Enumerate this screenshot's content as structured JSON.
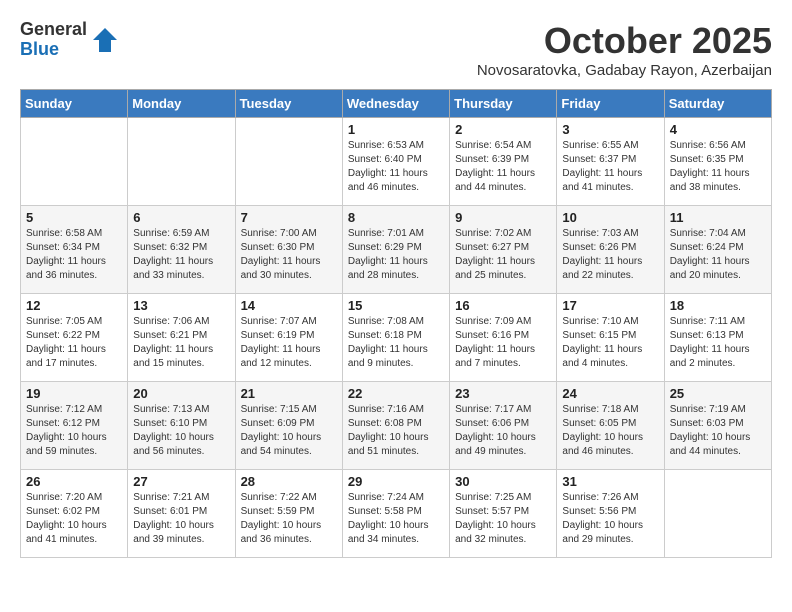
{
  "header": {
    "logo_general": "General",
    "logo_blue": "Blue",
    "month_title": "October 2025",
    "location": "Novosaratovka, Gadabay Rayon, Azerbaijan"
  },
  "weekdays": [
    "Sunday",
    "Monday",
    "Tuesday",
    "Wednesday",
    "Thursday",
    "Friday",
    "Saturday"
  ],
  "weeks": [
    [
      {
        "day": "",
        "info": ""
      },
      {
        "day": "",
        "info": ""
      },
      {
        "day": "",
        "info": ""
      },
      {
        "day": "1",
        "info": "Sunrise: 6:53 AM\nSunset: 6:40 PM\nDaylight: 11 hours\nand 46 minutes."
      },
      {
        "day": "2",
        "info": "Sunrise: 6:54 AM\nSunset: 6:39 PM\nDaylight: 11 hours\nand 44 minutes."
      },
      {
        "day": "3",
        "info": "Sunrise: 6:55 AM\nSunset: 6:37 PM\nDaylight: 11 hours\nand 41 minutes."
      },
      {
        "day": "4",
        "info": "Sunrise: 6:56 AM\nSunset: 6:35 PM\nDaylight: 11 hours\nand 38 minutes."
      }
    ],
    [
      {
        "day": "5",
        "info": "Sunrise: 6:58 AM\nSunset: 6:34 PM\nDaylight: 11 hours\nand 36 minutes."
      },
      {
        "day": "6",
        "info": "Sunrise: 6:59 AM\nSunset: 6:32 PM\nDaylight: 11 hours\nand 33 minutes."
      },
      {
        "day": "7",
        "info": "Sunrise: 7:00 AM\nSunset: 6:30 PM\nDaylight: 11 hours\nand 30 minutes."
      },
      {
        "day": "8",
        "info": "Sunrise: 7:01 AM\nSunset: 6:29 PM\nDaylight: 11 hours\nand 28 minutes."
      },
      {
        "day": "9",
        "info": "Sunrise: 7:02 AM\nSunset: 6:27 PM\nDaylight: 11 hours\nand 25 minutes."
      },
      {
        "day": "10",
        "info": "Sunrise: 7:03 AM\nSunset: 6:26 PM\nDaylight: 11 hours\nand 22 minutes."
      },
      {
        "day": "11",
        "info": "Sunrise: 7:04 AM\nSunset: 6:24 PM\nDaylight: 11 hours\nand 20 minutes."
      }
    ],
    [
      {
        "day": "12",
        "info": "Sunrise: 7:05 AM\nSunset: 6:22 PM\nDaylight: 11 hours\nand 17 minutes."
      },
      {
        "day": "13",
        "info": "Sunrise: 7:06 AM\nSunset: 6:21 PM\nDaylight: 11 hours\nand 15 minutes."
      },
      {
        "day": "14",
        "info": "Sunrise: 7:07 AM\nSunset: 6:19 PM\nDaylight: 11 hours\nand 12 minutes."
      },
      {
        "day": "15",
        "info": "Sunrise: 7:08 AM\nSunset: 6:18 PM\nDaylight: 11 hours\nand 9 minutes."
      },
      {
        "day": "16",
        "info": "Sunrise: 7:09 AM\nSunset: 6:16 PM\nDaylight: 11 hours\nand 7 minutes."
      },
      {
        "day": "17",
        "info": "Sunrise: 7:10 AM\nSunset: 6:15 PM\nDaylight: 11 hours\nand 4 minutes."
      },
      {
        "day": "18",
        "info": "Sunrise: 7:11 AM\nSunset: 6:13 PM\nDaylight: 11 hours\nand 2 minutes."
      }
    ],
    [
      {
        "day": "19",
        "info": "Sunrise: 7:12 AM\nSunset: 6:12 PM\nDaylight: 10 hours\nand 59 minutes."
      },
      {
        "day": "20",
        "info": "Sunrise: 7:13 AM\nSunset: 6:10 PM\nDaylight: 10 hours\nand 56 minutes."
      },
      {
        "day": "21",
        "info": "Sunrise: 7:15 AM\nSunset: 6:09 PM\nDaylight: 10 hours\nand 54 minutes."
      },
      {
        "day": "22",
        "info": "Sunrise: 7:16 AM\nSunset: 6:08 PM\nDaylight: 10 hours\nand 51 minutes."
      },
      {
        "day": "23",
        "info": "Sunrise: 7:17 AM\nSunset: 6:06 PM\nDaylight: 10 hours\nand 49 minutes."
      },
      {
        "day": "24",
        "info": "Sunrise: 7:18 AM\nSunset: 6:05 PM\nDaylight: 10 hours\nand 46 minutes."
      },
      {
        "day": "25",
        "info": "Sunrise: 7:19 AM\nSunset: 6:03 PM\nDaylight: 10 hours\nand 44 minutes."
      }
    ],
    [
      {
        "day": "26",
        "info": "Sunrise: 7:20 AM\nSunset: 6:02 PM\nDaylight: 10 hours\nand 41 minutes."
      },
      {
        "day": "27",
        "info": "Sunrise: 7:21 AM\nSunset: 6:01 PM\nDaylight: 10 hours\nand 39 minutes."
      },
      {
        "day": "28",
        "info": "Sunrise: 7:22 AM\nSunset: 5:59 PM\nDaylight: 10 hours\nand 36 minutes."
      },
      {
        "day": "29",
        "info": "Sunrise: 7:24 AM\nSunset: 5:58 PM\nDaylight: 10 hours\nand 34 minutes."
      },
      {
        "day": "30",
        "info": "Sunrise: 7:25 AM\nSunset: 5:57 PM\nDaylight: 10 hours\nand 32 minutes."
      },
      {
        "day": "31",
        "info": "Sunrise: 7:26 AM\nSunset: 5:56 PM\nDaylight: 10 hours\nand 29 minutes."
      },
      {
        "day": "",
        "info": ""
      }
    ]
  ]
}
